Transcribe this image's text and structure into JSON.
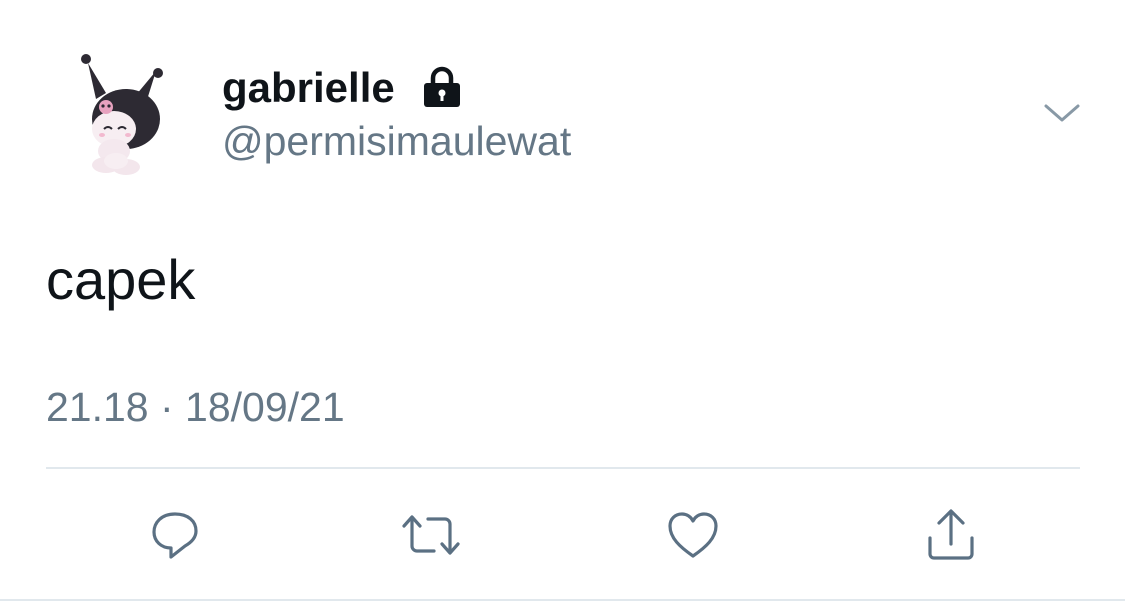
{
  "tweet": {
    "display_name": "gabrielle",
    "handle": "@permisimaulewat",
    "text": "capek",
    "timestamp": "21.18 · 18/09/21",
    "protected_icon": "lock-icon",
    "menu_icon": "chevron-down-icon"
  },
  "actions": [
    {
      "icon": "reply-icon"
    },
    {
      "icon": "retweet-icon"
    },
    {
      "icon": "like-icon"
    },
    {
      "icon": "share-icon"
    }
  ],
  "colors": {
    "text_primary": "#0f1419",
    "text_secondary": "#657786",
    "icon": "#5b7083",
    "divider": "#e1e8ed"
  }
}
